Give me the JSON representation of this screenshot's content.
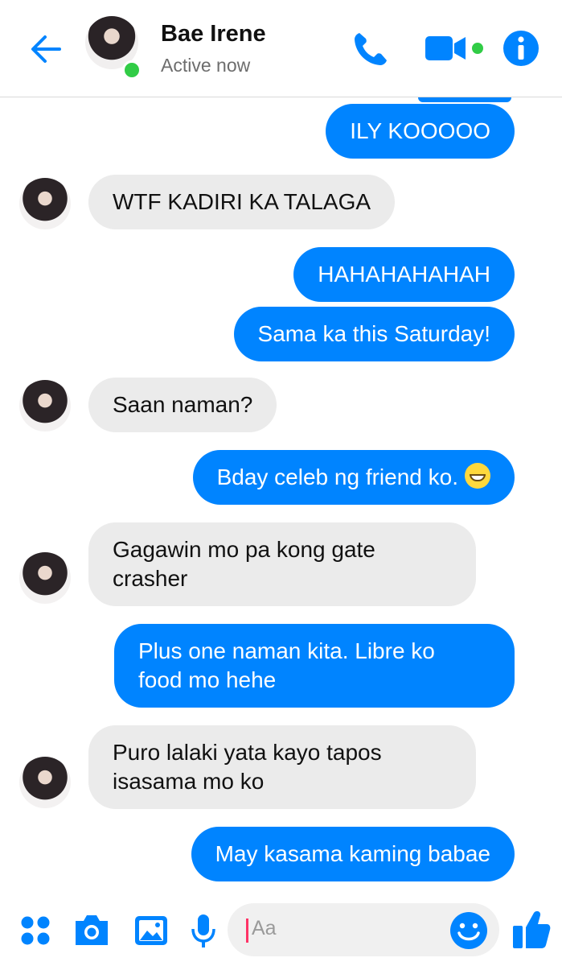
{
  "header": {
    "contact_name": "Bae Irene",
    "status": "Active now"
  },
  "messages": [
    {
      "from": "me",
      "text": "ILY KOOOOO"
    },
    {
      "from": "them",
      "text": "WTF KADIRI KA TALAGA"
    },
    {
      "from": "me",
      "text": "HAHAHAHAHAH"
    },
    {
      "from": "me",
      "text": "Sama ka this Saturday!"
    },
    {
      "from": "them",
      "text": "Saan naman?"
    },
    {
      "from": "me",
      "text": "Bday celeb ng friend ko.",
      "emoji": "grinning-face"
    },
    {
      "from": "them",
      "line1": "Gagawin mo pa kong gate",
      "line2": "crasher"
    },
    {
      "from": "me",
      "line1": "Plus one naman kita. Libre ko",
      "line2": "food mo hehe"
    },
    {
      "from": "them",
      "line1": "Puro lalaki yata kayo tapos",
      "line2": "isasama mo ko"
    },
    {
      "from": "me",
      "text": "May kasama kaming babae"
    }
  ],
  "composer": {
    "placeholder": "Aa",
    "icons": [
      "apps-icon",
      "camera-icon",
      "gallery-icon",
      "mic-icon",
      "emoji-icon",
      "thumbs-up-icon"
    ]
  },
  "colors": {
    "accent": "#0084ff",
    "incoming_bubble": "#ebebeb",
    "online": "#31cc46"
  }
}
